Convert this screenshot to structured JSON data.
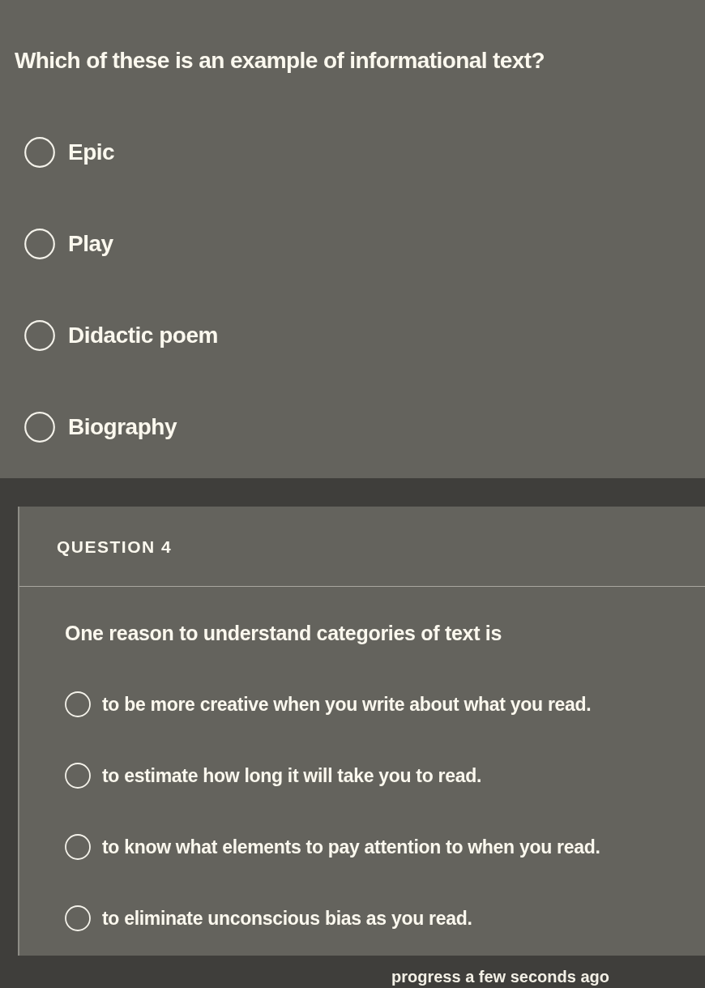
{
  "questions": [
    {
      "prompt": "Which of these is an example of informational text?",
      "options": [
        {
          "label": "Epic",
          "selected": false
        },
        {
          "label": "Play",
          "selected": false
        },
        {
          "label": "Didactic poem",
          "selected": false
        },
        {
          "label": "Biography",
          "selected": false
        }
      ]
    },
    {
      "header": "QUESTION 4",
      "prompt": "One reason to understand categories of text is",
      "options": [
        {
          "label": "to be more creative when you write about what you read.",
          "selected": false
        },
        {
          "label": "to estimate how long it will take you to read.",
          "selected": false
        },
        {
          "label": "to know what elements to pay attention to when you read.",
          "selected": false
        },
        {
          "label": "to eliminate unconscious bias as you read.",
          "selected": false
        }
      ]
    }
  ],
  "status_bar": {
    "text": "progress a few seconds ago"
  }
}
